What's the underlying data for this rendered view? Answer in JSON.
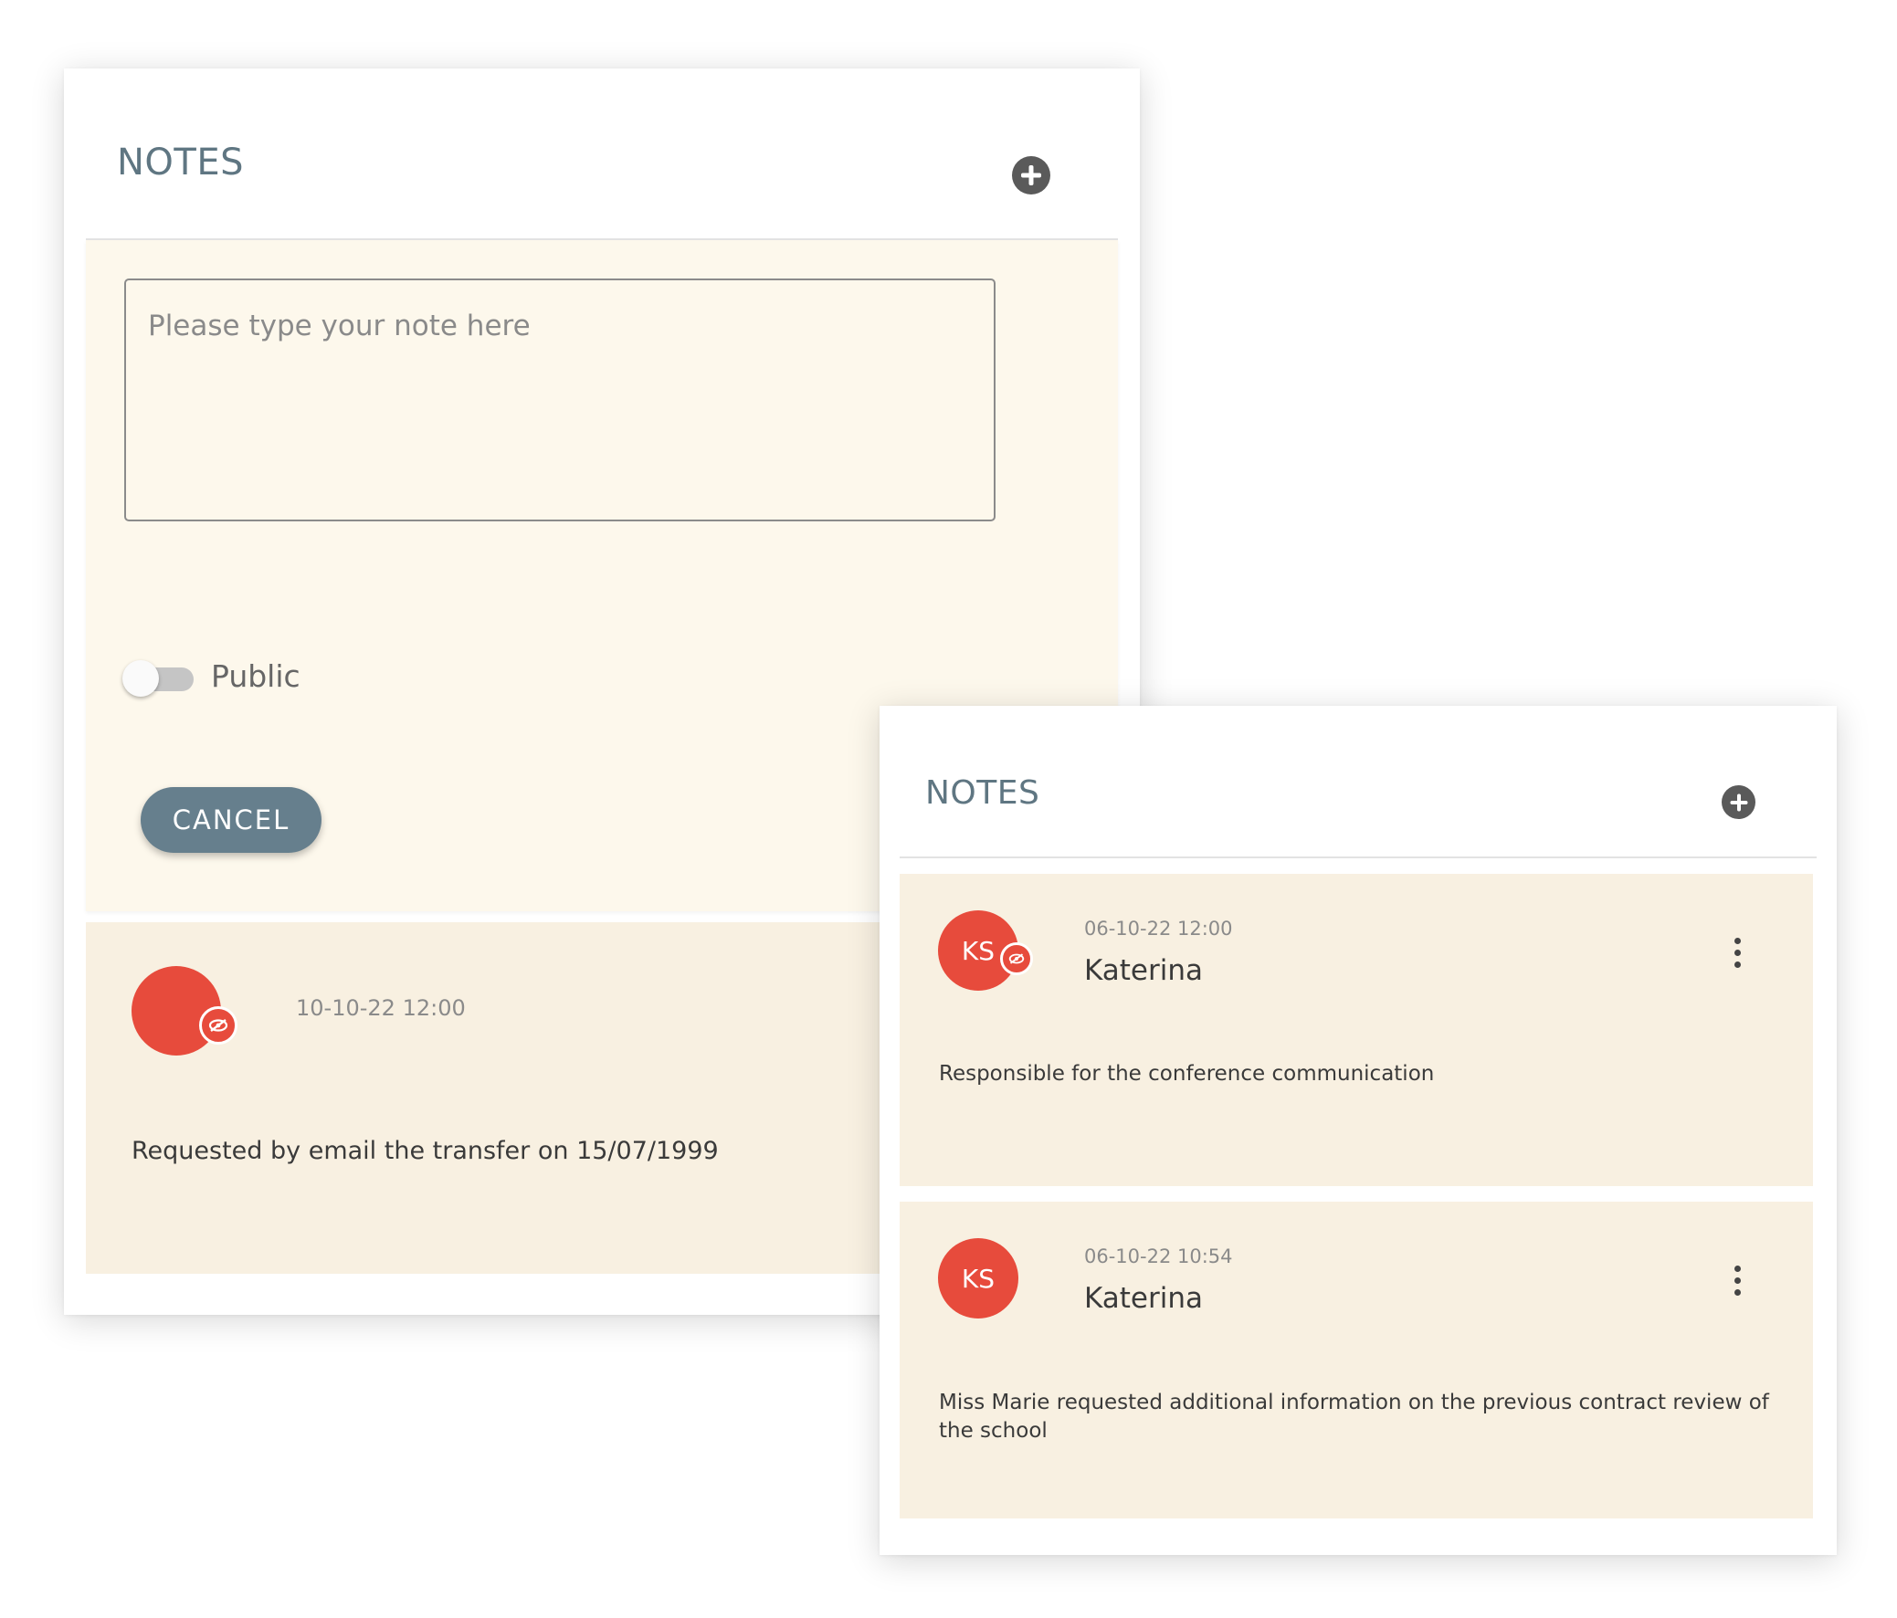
{
  "left_panel": {
    "title": "NOTES",
    "form": {
      "textarea_placeholder": "Please type your note here",
      "textarea_value": "",
      "toggle_label": "Public",
      "toggle_on": false,
      "cancel_label": "CANCEL"
    },
    "notes": [
      {
        "avatar_initials": "",
        "private_icon": "eye-off-icon",
        "timestamp": "10-10-22 12:00",
        "author": "",
        "text": "Requested by email the transfer on 15/07/1999"
      }
    ]
  },
  "right_panel": {
    "title": "NOTES",
    "notes": [
      {
        "avatar_initials": "KS",
        "private_icon": "eye-off-icon",
        "timestamp": "06-10-22 12:00",
        "author": "Katerina",
        "text": "Responsible for the conference communication"
      },
      {
        "avatar_initials": "KS",
        "timestamp": "06-10-22 10:54",
        "author": "Katerina",
        "text": "Miss Marie requested additional information on the previous contract review of the school"
      }
    ]
  },
  "colors": {
    "title": "#5f7682",
    "add_icon": "#5a5a5a",
    "form_background": "#fdf8ec",
    "note_background": "#f8f0e1",
    "avatar": "#e74b3c",
    "cancel_button": "#667f8d"
  }
}
